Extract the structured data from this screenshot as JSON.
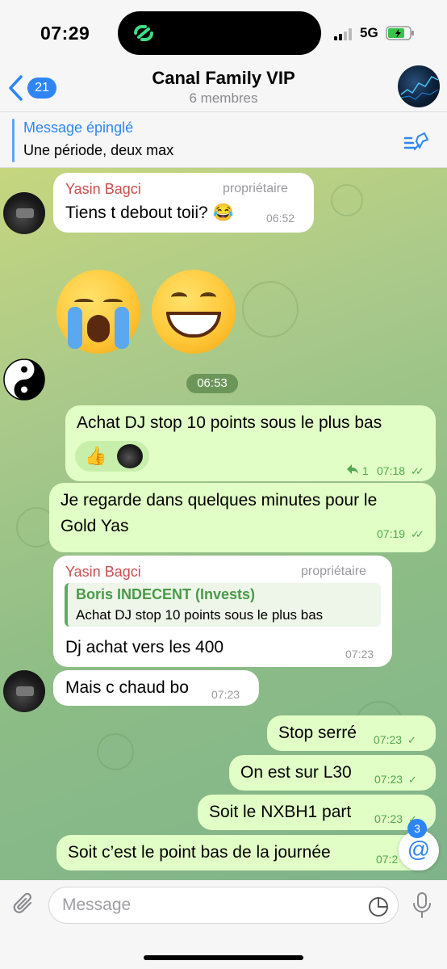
{
  "status": {
    "time": "07:29",
    "network": "5G"
  },
  "header": {
    "back_count": "21",
    "title": "Canal Family VIP",
    "subtitle": "6 membres"
  },
  "pinned": {
    "title": "Message épinglé",
    "text": "Une période, deux max"
  },
  "messages": [
    {
      "sender": "Yasin Bagci",
      "role": "propriétaire",
      "text": "Tiens t debout toii? 😂",
      "time": "06:52"
    },
    {
      "emojis": "😭😄"
    },
    {
      "date_pill": "06:53"
    },
    {
      "text": "Achat DJ stop 10 points sous le plus bas",
      "reaction": "👍",
      "replies": "1",
      "time": "07:18"
    },
    {
      "text_line1": "Je regarde dans quelques minutes pour le",
      "text_line2": "Gold Yas",
      "time": "07:19"
    },
    {
      "sender": "Yasin Bagci",
      "role": "propriétaire",
      "quote_name": "Boris INDECENT (Invests)",
      "quote_text": "Achat DJ stop 10 points sous le plus bas",
      "text": "Dj achat vers les 400",
      "time": "07:23"
    },
    {
      "text": "Mais c chaud bo",
      "time": "07:23"
    },
    {
      "text": "Stop serré",
      "time": "07:23"
    },
    {
      "text": "On est sur L30",
      "time": "07:23"
    },
    {
      "text": "Soit le NXBH1 part",
      "time": "07:23"
    },
    {
      "text": "Soit c’est le point bas de la journée",
      "time": "07:2"
    }
  ],
  "mention_count": "3",
  "input": {
    "placeholder": "Message"
  },
  "colors": {
    "accent": "#2e86f4",
    "outgoing_bubble": "#e1fec6",
    "incoming_bubble": "#ffffff",
    "sender_name": "#c94e4e",
    "read_ticks": "#4fa94d"
  },
  "icons": [
    "signal-icon",
    "battery-icon",
    "chevron-left-icon",
    "pin-list-icon",
    "paperclip-icon",
    "sticker-icon",
    "microphone-icon",
    "at-icon",
    "reply-icon"
  ]
}
